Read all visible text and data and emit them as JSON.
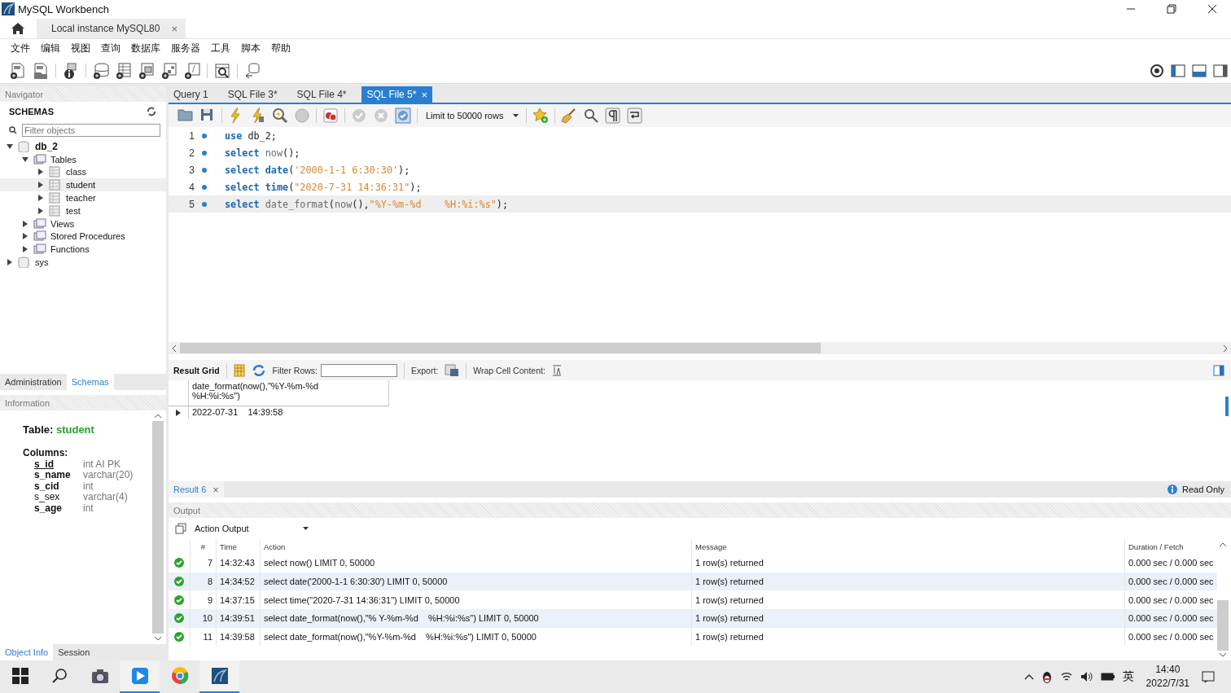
{
  "window": {
    "title": "MySQL Workbench"
  },
  "connection_tabs": [
    {
      "label": "Local instance MySQL80",
      "selected": true,
      "close": "×"
    }
  ],
  "menu": [
    "文件",
    "编辑",
    "视图",
    "查询",
    "数据库",
    "服务器",
    "工具",
    "脚本",
    "帮助"
  ],
  "navigator": {
    "title": "Navigator",
    "schemas_title": "SCHEMAS",
    "filter": {
      "placeholder": "Filter objects"
    },
    "tree": [
      {
        "label": "db_2",
        "kind": "schema",
        "default": true,
        "expanded": true,
        "selected": false,
        "children": [
          {
            "label": "Tables",
            "kind": "folder",
            "expanded": true,
            "selected": false,
            "children": [
              {
                "label": "class",
                "kind": "table",
                "expanded": false,
                "selected": false
              },
              {
                "label": "student",
                "kind": "table",
                "expanded": false,
                "selected": true
              },
              {
                "label": "teacher",
                "kind": "table",
                "expanded": false,
                "selected": false
              },
              {
                "label": "test",
                "kind": "table",
                "expanded": false,
                "selected": false
              }
            ]
          },
          {
            "label": "Views",
            "kind": "folder",
            "expanded": false,
            "selected": false
          },
          {
            "label": "Stored Procedures",
            "kind": "folder",
            "expanded": false,
            "selected": false
          },
          {
            "label": "Functions",
            "kind": "folder",
            "expanded": false,
            "selected": false
          }
        ]
      },
      {
        "label": "sys",
        "kind": "schema",
        "default": false,
        "expanded": false,
        "selected": false
      }
    ],
    "tabs": [
      {
        "label": "Administration",
        "selected": false
      },
      {
        "label": "Schemas",
        "selected": true
      }
    ]
  },
  "information": {
    "title": "Information",
    "table_label": "Table:",
    "table_name": "student",
    "columns_label": "Columns:",
    "columns": [
      {
        "name": "s_id",
        "type": "int AI PK",
        "bold": true,
        "underlined": true
      },
      {
        "name": "s_name",
        "type": "varchar(20)",
        "bold": true,
        "underlined": false
      },
      {
        "name": "s_cid",
        "type": "int",
        "bold": true,
        "underlined": false
      },
      {
        "name": "s_sex",
        "type": "varchar(4)",
        "bold": false,
        "underlined": false
      },
      {
        "name": "s_age",
        "type": "int",
        "bold": true,
        "underlined": false
      }
    ],
    "tabs": [
      {
        "label": "Object Info",
        "selected": true
      },
      {
        "label": "Session",
        "selected": false
      }
    ]
  },
  "query_tabs": [
    {
      "label": "Query 1",
      "selected": false
    },
    {
      "label": "SQL File 3*",
      "selected": false
    },
    {
      "label": "SQL File 4*",
      "selected": false
    },
    {
      "label": "SQL File 5*",
      "selected": true,
      "close": "×"
    }
  ],
  "editor": {
    "limit": "Limit to 50000 rows",
    "lines": [
      {
        "number": "1",
        "current": false,
        "tokens": [
          {
            "kind": "keyword",
            "text": "use"
          },
          {
            "kind": "plain",
            "text": " db_2;"
          }
        ]
      },
      {
        "number": "2",
        "current": false,
        "tokens": [
          {
            "kind": "keyword",
            "text": "select "
          },
          {
            "kind": "function",
            "text": "now"
          },
          {
            "kind": "plain",
            "text": "();"
          }
        ]
      },
      {
        "number": "3",
        "current": false,
        "tokens": [
          {
            "kind": "keyword",
            "text": "select date"
          },
          {
            "kind": "plain",
            "text": "("
          },
          {
            "kind": "string",
            "text": "'2000-1-1 6:30:30'"
          },
          {
            "kind": "plain",
            "text": ");"
          }
        ]
      },
      {
        "number": "4",
        "current": false,
        "tokens": [
          {
            "kind": "keyword",
            "text": "select time"
          },
          {
            "kind": "plain",
            "text": "("
          },
          {
            "kind": "string",
            "text": "\"2020-7-31 14:36:31\""
          },
          {
            "kind": "plain",
            "text": ");"
          }
        ]
      },
      {
        "number": "5",
        "current": true,
        "tokens": [
          {
            "kind": "keyword",
            "text": "select "
          },
          {
            "kind": "function",
            "text": "date_format"
          },
          {
            "kind": "plain",
            "text": "("
          },
          {
            "kind": "function",
            "text": "now"
          },
          {
            "kind": "plain",
            "text": "(),"
          },
          {
            "kind": "string",
            "text": "\"%Y-%m-%d    %H:%i:%s\""
          },
          {
            "kind": "plain",
            "text": ");"
          }
        ]
      }
    ]
  },
  "result": {
    "title": "Result Grid",
    "filter_label": "Filter Rows:",
    "export_label": "Export:",
    "wrap_label": "Wrap Cell Content:",
    "column": "date_format(now(),\"%Y-%m-%d    %H:%i:%s\")",
    "rows": [
      "2022-07-31    14:39:58"
    ]
  },
  "result_tabs": [
    {
      "label": "Result 6",
      "selected": true,
      "close": "×"
    }
  ],
  "read_only": "Read Only",
  "output": {
    "title": "Output",
    "mode": "Action Output",
    "columns": [
      "#",
      "Time",
      "Action",
      "Message",
      "Duration / Fetch"
    ],
    "rows": [
      {
        "succeeded": true,
        "number": "7",
        "time": "14:32:43",
        "action": "select now() LIMIT 0, 50000",
        "message": "1 row(s) returned",
        "duration": "0.000 sec / 0.000 sec"
      },
      {
        "succeeded": true,
        "number": "8",
        "time": "14:34:52",
        "action": "select date('2000-1-1 6:30:30') LIMIT 0, 50000",
        "message": "1 row(s) returned",
        "duration": "0.000 sec / 0.000 sec"
      },
      {
        "succeeded": true,
        "number": "9",
        "time": "14:37:15",
        "action": "select time(\"2020-7-31 14:36:31\") LIMIT 0, 50000",
        "message": "1 row(s) returned",
        "duration": "0.000 sec / 0.000 sec"
      },
      {
        "succeeded": true,
        "number": "10",
        "time": "14:39:51",
        "action": "select date_format(now(),\"% Y-%m-%d    %H:%i:%s\") LIMIT 0, 50000",
        "message": "1 row(s) returned",
        "duration": "0.000 sec / 0.000 sec"
      },
      {
        "succeeded": true,
        "number": "11",
        "time": "14:39:58",
        "action": "select date_format(now(),\"%Y-%m-%d    %H:%i:%s\") LIMIT 0, 50000",
        "message": "1 row(s) returned",
        "duration": "0.000 sec / 0.000 sec"
      }
    ]
  },
  "taskbar": {
    "ime": "英",
    "time": "14:40",
    "date": "2022/7/31"
  }
}
